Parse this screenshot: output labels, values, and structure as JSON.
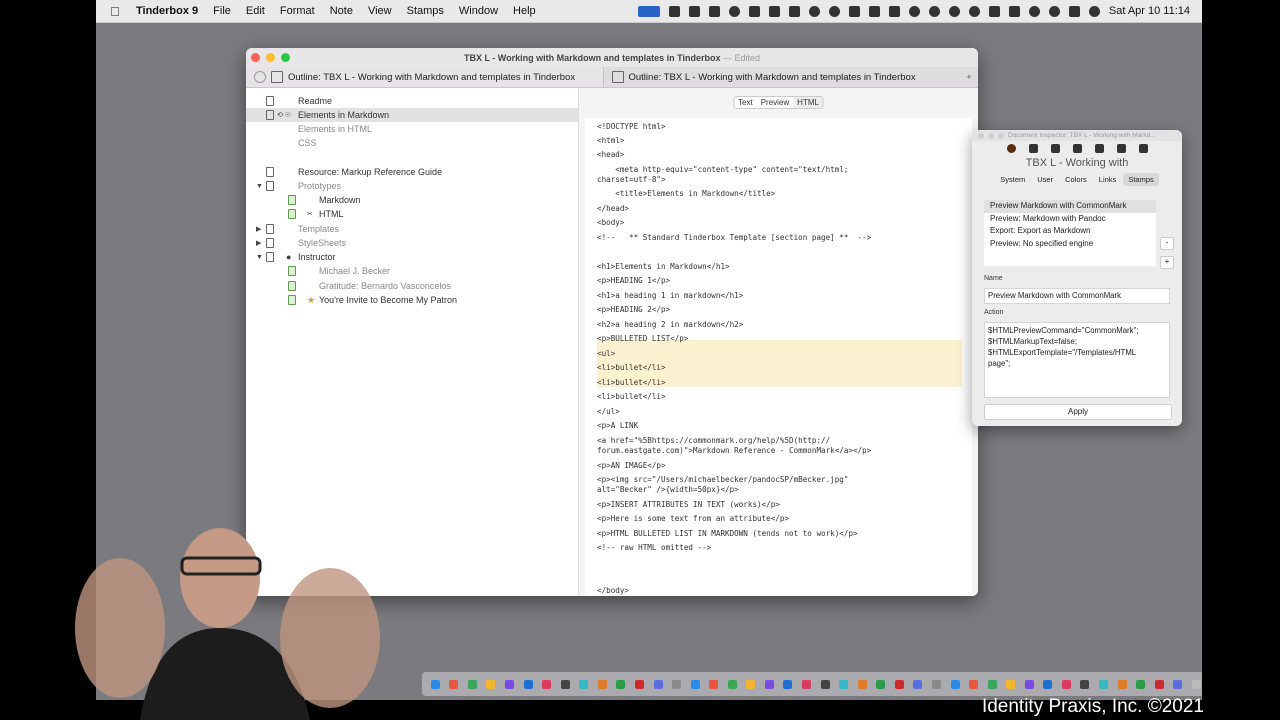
{
  "menubar": {
    "app": "Tinderbox 9",
    "items": [
      "File",
      "Edit",
      "Format",
      "Note",
      "View",
      "Stamps",
      "Window",
      "Help"
    ],
    "clock": "Sat Apr 10  11:14"
  },
  "window": {
    "title": "TBX L - Working with Markdown and templates in Tinderbox",
    "edited": "— Edited",
    "tabs": [
      "Outline: TBX L - Working with Markdown and templates in Tinderbox",
      "Outline: TBX L - Working with Markdown and templates in Tinderbox"
    ],
    "newtab": "+"
  },
  "outline": {
    "rows": [
      {
        "label": "Readme",
        "indent": 0,
        "muted": false,
        "disclosure": ""
      },
      {
        "label": "Elements in Markdown",
        "indent": 0,
        "muted": false,
        "disclosure": "",
        "selected": true
      },
      {
        "label": "Elements in HTML",
        "indent": 0,
        "muted": true,
        "disclosure": ""
      },
      {
        "label": "CSS",
        "indent": 0,
        "muted": true,
        "disclosure": ""
      },
      {
        "label": "",
        "indent": 0,
        "muted": false,
        "disclosure": ""
      },
      {
        "label": "Resource: Markup Reference Guide",
        "indent": 0,
        "muted": false,
        "disclosure": ""
      },
      {
        "label": "Prototypes",
        "indent": 0,
        "muted": true,
        "disclosure": "▼"
      },
      {
        "label": "Markdown",
        "indent": 1,
        "muted": false,
        "disclosure": ""
      },
      {
        "label": "HTML",
        "indent": 1,
        "muted": false,
        "disclosure": ""
      },
      {
        "label": "Templates",
        "indent": 0,
        "muted": true,
        "disclosure": "▶"
      },
      {
        "label": "StyleSheets",
        "indent": 0,
        "muted": true,
        "disclosure": "▶"
      },
      {
        "label": "Instructor",
        "indent": 0,
        "muted": false,
        "disclosure": "▼"
      },
      {
        "label": "Michael J. Becker",
        "indent": 1,
        "muted": true,
        "disclosure": ""
      },
      {
        "label": "Gratitude: Bernardo Vasconcelos",
        "indent": 1,
        "muted": true,
        "disclosure": ""
      },
      {
        "label": "You're Invite to Become My Patron",
        "indent": 1,
        "muted": false,
        "disclosure": ""
      }
    ]
  },
  "editor": {
    "modes": [
      "Text",
      "Preview",
      "HTML"
    ],
    "active_mode": "HTML",
    "lines": [
      "<!DOCTYPE html>",
      "<html>",
      "<head>",
      "    <meta http-equiv=\"content-type\" content=\"text/html;",
      "charset=utf-8\">",
      "    <title>Elements in Markdown</title>",
      "</head>",
      "<body>",
      "<!--   ** Standard Tinderbox Template [section page] **  -->",
      "",
      "<h1>Elements in Markdown</h1>",
      "<p>HEADING 1</p>",
      "<h1>a heading 1 in markdown</h1>",
      "<p>HEADING 2</p>",
      "<h2>a heading 2 in markdown</h2>",
      "<p>BULLETED LIST</p>",
      "<ul>",
      "<li>bullet</li>",
      "<li>bullet</li>",
      "<li>bullet</li>",
      "</ul>",
      "<p>A LINK",
      "<a href=\"%5Bhttps://commonmark.org/help/%5D(http://",
      "forum.eastgate.com)\">Markdown Reference - CommonMark</a></p>",
      "<p>AN IMAGE</p>",
      "<p><img src=\"/Users/michaelbecker/pandocSP/mBecker.jpg\"",
      "alt=\"Becker\" />{width=50px}</p>",
      "<p>INSERT ATTRIBUTES IN TEXT (works)</p>",
      "<p>Here is some text from an attribute</p>",
      "<p>HTML BULLETED LIST IN MARKDOWN (tends not to work)</p>",
      "<!-- raw HTML omitted -->",
      "",
      "",
      "</body>"
    ]
  },
  "inspector": {
    "title": "Document Inspector: TBX L - Working with Markd...",
    "heading": "TBX L - Working with",
    "tabs": [
      "System",
      "User",
      "Colors",
      "Links",
      "Stamps"
    ],
    "active_tab": "Stamps",
    "stamps": [
      "Preview Markdown with CommonMark",
      "Preview: Markdown with Pandoc",
      "Export: Export as Markdown",
      "Preview: No specified engine"
    ],
    "minus": "-",
    "plus": "+",
    "name_label": "Name",
    "name_value": "Preview Markdown with CommonMark",
    "action_label": "Action",
    "action_value": "$HTMLPreviewCommand=\"CommonMark\";\n$HTMLMarkupText=false;\n$HTMLExportTemplate=\"/Templates/HTML\npage\";",
    "apply": "Apply"
  },
  "watermark": "Identity Praxis, Inc. ©2021"
}
